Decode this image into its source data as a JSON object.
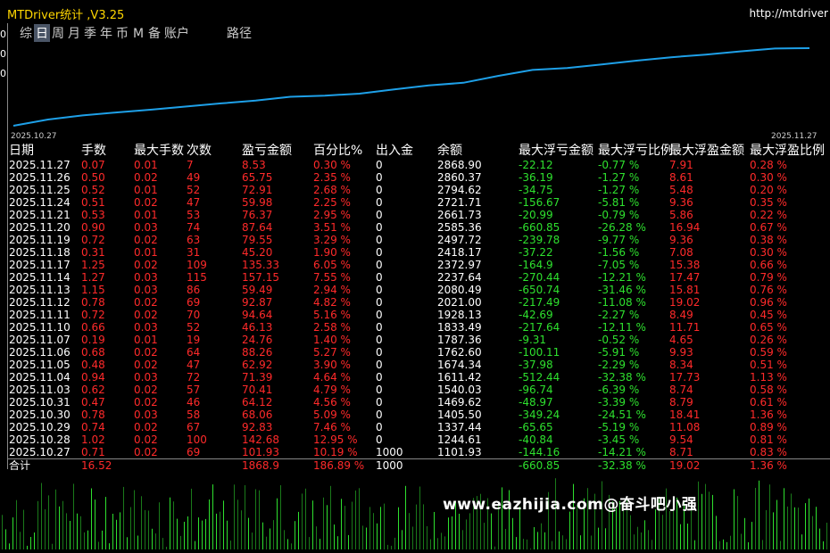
{
  "window": {
    "title": "MTDriver统计 ,V3.25",
    "url": "http://mtdriver"
  },
  "tabs": [
    {
      "label": "综",
      "active": false
    },
    {
      "label": "日",
      "active": true
    },
    {
      "label": "周",
      "active": false
    },
    {
      "label": "月",
      "active": false
    },
    {
      "label": "季",
      "active": false
    },
    {
      "label": "年",
      "active": false
    },
    {
      "label": "币",
      "active": false
    },
    {
      "label": "M",
      "active": false
    },
    {
      "label": "备",
      "active": false
    },
    {
      "label": "账户",
      "active": false
    },
    {
      "label": "路径",
      "active": false
    }
  ],
  "left_axis": [
    "0",
    "0",
    "0"
  ],
  "chart_data": {
    "type": "line",
    "x": [
      "2025.10.27",
      "2025.10.28",
      "2025.10.29",
      "2025.10.30",
      "2025.10.31",
      "2025.11.03",
      "2025.11.04",
      "2025.11.05",
      "2025.11.06",
      "2025.11.07",
      "2025.11.10",
      "2025.11.11",
      "2025.11.12",
      "2025.11.13",
      "2025.11.14",
      "2025.11.17",
      "2025.11.18",
      "2025.11.19",
      "2025.11.20",
      "2025.11.21",
      "2025.11.24",
      "2025.11.25",
      "2025.11.26",
      "2025.11.27"
    ],
    "x_labels": [
      "2025.10.27",
      "2025.11.27"
    ],
    "series": [
      {
        "values": [
          1101.93,
          1244.61,
          1337.44,
          1405.5,
          1469.62,
          1540.03,
          1611.42,
          1674.34,
          1762.6,
          1787.36,
          1833.49,
          1928.13,
          2021.0,
          2080.49,
          2237.64,
          2372.97,
          2418.17,
          2497.72,
          2585.36,
          2661.73,
          2721.71,
          2794.62,
          2860.37,
          2868.9
        ],
        "color": "#1ea0e8"
      }
    ],
    "ylim": [
      1000,
      2950
    ],
    "grid": false
  },
  "table": {
    "headers": [
      "日期",
      "手数",
      "最大手数",
      "次数",
      "盈亏金额",
      "百分比%",
      "出入金",
      "余额",
      "最大浮亏金额",
      "最大浮亏比例",
      "最大浮盈金额",
      "最大浮盈比例"
    ],
    "rows": [
      [
        "2025.11.27",
        "0.07",
        "0.01",
        "7",
        "8.53",
        "0.30 %",
        "0",
        "2868.90",
        "-22.12",
        "-0.77 %",
        "7.91",
        "0.28 %"
      ],
      [
        "2025.11.26",
        "0.50",
        "0.02",
        "49",
        "65.75",
        "2.35 %",
        "0",
        "2860.37",
        "-36.19",
        "-1.27 %",
        "8.61",
        "0.30 %"
      ],
      [
        "2025.11.25",
        "0.52",
        "0.01",
        "52",
        "72.91",
        "2.68 %",
        "0",
        "2794.62",
        "-34.75",
        "-1.27 %",
        "5.48",
        "0.20 %"
      ],
      [
        "2025.11.24",
        "0.51",
        "0.02",
        "47",
        "59.98",
        "2.25 %",
        "0",
        "2721.71",
        "-156.67",
        "-5.81 %",
        "9.36",
        "0.35 %"
      ],
      [
        "2025.11.21",
        "0.53",
        "0.01",
        "53",
        "76.37",
        "2.95 %",
        "0",
        "2661.73",
        "-20.99",
        "-0.79 %",
        "5.86",
        "0.22 %"
      ],
      [
        "2025.11.20",
        "0.90",
        "0.03",
        "74",
        "87.64",
        "3.51 %",
        "0",
        "2585.36",
        "-660.85",
        "-26.28 %",
        "16.94",
        "0.67 %"
      ],
      [
        "2025.11.19",
        "0.72",
        "0.02",
        "63",
        "79.55",
        "3.29 %",
        "0",
        "2497.72",
        "-239.78",
        "-9.77 %",
        "9.36",
        "0.38 %"
      ],
      [
        "2025.11.18",
        "0.31",
        "0.01",
        "31",
        "45.20",
        "1.90 %",
        "0",
        "2418.17",
        "-37.22",
        "-1.56 %",
        "7.08",
        "0.30 %"
      ],
      [
        "2025.11.17",
        "1.25",
        "0.02",
        "109",
        "135.33",
        "6.05 %",
        "0",
        "2372.97",
        "-164.9",
        "-7.05 %",
        "15.38",
        "0.66 %"
      ],
      [
        "2025.11.14",
        "1.27",
        "0.03",
        "115",
        "157.15",
        "7.55 %",
        "0",
        "2237.64",
        "-270.44",
        "-12.21 %",
        "17.47",
        "0.79 %"
      ],
      [
        "2025.11.13",
        "1.15",
        "0.03",
        "86",
        "59.49",
        "2.94 %",
        "0",
        "2080.49",
        "-650.74",
        "-31.46 %",
        "15.81",
        "0.76 %"
      ],
      [
        "2025.11.12",
        "0.78",
        "0.02",
        "69",
        "92.87",
        "4.82 %",
        "0",
        "2021.00",
        "-217.49",
        "-11.08 %",
        "19.02",
        "0.96 %"
      ],
      [
        "2025.11.11",
        "0.72",
        "0.02",
        "70",
        "94.64",
        "5.16 %",
        "0",
        "1928.13",
        "-42.69",
        "-2.27 %",
        "8.49",
        "0.45 %"
      ],
      [
        "2025.11.10",
        "0.66",
        "0.03",
        "52",
        "46.13",
        "2.58 %",
        "0",
        "1833.49",
        "-217.64",
        "-12.11 %",
        "11.71",
        "0.65 %"
      ],
      [
        "2025.11.07",
        "0.19",
        "0.01",
        "19",
        "24.76",
        "1.40 %",
        "0",
        "1787.36",
        "-9.31",
        "-0.52 %",
        "4.65",
        "0.26 %"
      ],
      [
        "2025.11.06",
        "0.68",
        "0.02",
        "64",
        "88.26",
        "5.27 %",
        "0",
        "1762.60",
        "-100.11",
        "-5.91 %",
        "9.93",
        "0.59 %"
      ],
      [
        "2025.11.05",
        "0.48",
        "0.02",
        "47",
        "62.92",
        "3.90 %",
        "0",
        "1674.34",
        "-37.98",
        "-2.29 %",
        "8.34",
        "0.51 %"
      ],
      [
        "2025.11.04",
        "0.94",
        "0.03",
        "72",
        "71.39",
        "4.64 %",
        "0",
        "1611.42",
        "-512.44",
        "-32.38 %",
        "17.73",
        "1.13 %"
      ],
      [
        "2025.11.03",
        "0.62",
        "0.02",
        "57",
        "70.41",
        "4.79 %",
        "0",
        "1540.03",
        "-96.74",
        "-6.39 %",
        "8.74",
        "0.58 %"
      ],
      [
        "2025.10.31",
        "0.47",
        "0.02",
        "46",
        "64.12",
        "4.56 %",
        "0",
        "1469.62",
        "-48.97",
        "-3.39 %",
        "8.79",
        "0.61 %"
      ],
      [
        "2025.10.30",
        "0.78",
        "0.03",
        "58",
        "68.06",
        "5.09 %",
        "0",
        "1405.50",
        "-349.24",
        "-24.51 %",
        "18.41",
        "1.36 %"
      ],
      [
        "2025.10.29",
        "0.74",
        "0.02",
        "67",
        "92.83",
        "7.46 %",
        "0",
        "1337.44",
        "-65.65",
        "-5.19 %",
        "11.08",
        "0.89 %"
      ],
      [
        "2025.10.28",
        "1.02",
        "0.02",
        "100",
        "142.68",
        "12.95 %",
        "0",
        "1244.61",
        "-40.84",
        "-3.45 %",
        "9.54",
        "0.81 %"
      ],
      [
        "2025.10.27",
        "0.71",
        "0.02",
        "69",
        "101.93",
        "10.19 %",
        "1000",
        "1101.93",
        "-144.16",
        "-14.21 %",
        "8.71",
        "0.83 %"
      ]
    ],
    "total": [
      "合计",
      "16.52",
      "",
      "",
      "1868.9",
      "186.89 %",
      "1000",
      "",
      "-660.85",
      "-32.38 %",
      "19.02",
      "1.36 %"
    ]
  },
  "watermark": "www.eazhijia.com@奋斗吧小强"
}
